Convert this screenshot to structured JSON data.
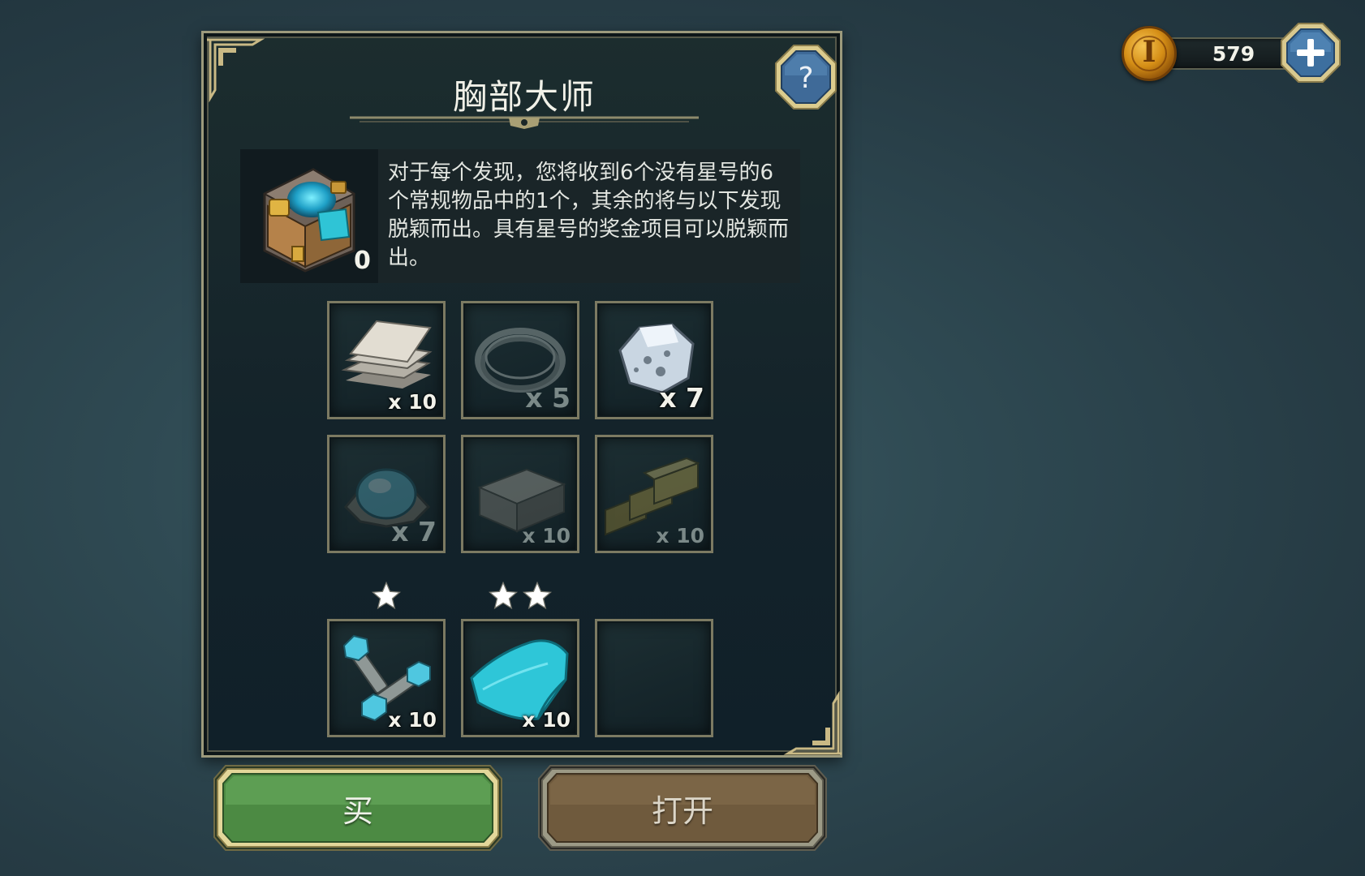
{
  "currency": {
    "amount": "579",
    "coin_glyph": "I",
    "coin_icon": "gold-coin-icon",
    "add_icon": "plus-icon"
  },
  "dialog": {
    "title": "胸部大师",
    "help_label": "?",
    "chest": {
      "icon": "treasure-chest-icon",
      "count": "0"
    },
    "description": "对于每个发现，您将收到6个没有星号的6个常规物品中的1个，其余的将与以下发现脱颖而出。具有星号的奖金项目可以脱颖而出。",
    "regular_items": [
      {
        "icon": "stone-slabs-icon",
        "qty": "x 10",
        "state": "available"
      },
      {
        "icon": "wire-coil-icon",
        "qty": "x 5",
        "state": "dimmed"
      },
      {
        "icon": "ore-chunk-icon",
        "qty": "x 7",
        "state": "available"
      },
      {
        "icon": "crystal-dome-icon",
        "qty": "x 7",
        "state": "dimmed"
      },
      {
        "icon": "stone-block-icon",
        "qty": "x 10",
        "state": "dimmed"
      },
      {
        "icon": "gold-bars-icon",
        "qty": "x 10",
        "state": "dimmed"
      }
    ],
    "bonus_items": [
      {
        "stars": 1,
        "icon": "bolts-icon",
        "qty": "x 10"
      },
      {
        "stars": 2,
        "icon": "cyan-fabric-icon",
        "qty": "x 10"
      },
      {
        "stars": 0,
        "icon": "",
        "qty": ""
      }
    ]
  },
  "buttons": {
    "buy": "买",
    "open": "打开"
  },
  "colors": {
    "buy_green": "#4c8a43",
    "open_brown": "#6f5a3d",
    "frame_gold": "#c9b985",
    "help_blue": "#3f6a98"
  }
}
